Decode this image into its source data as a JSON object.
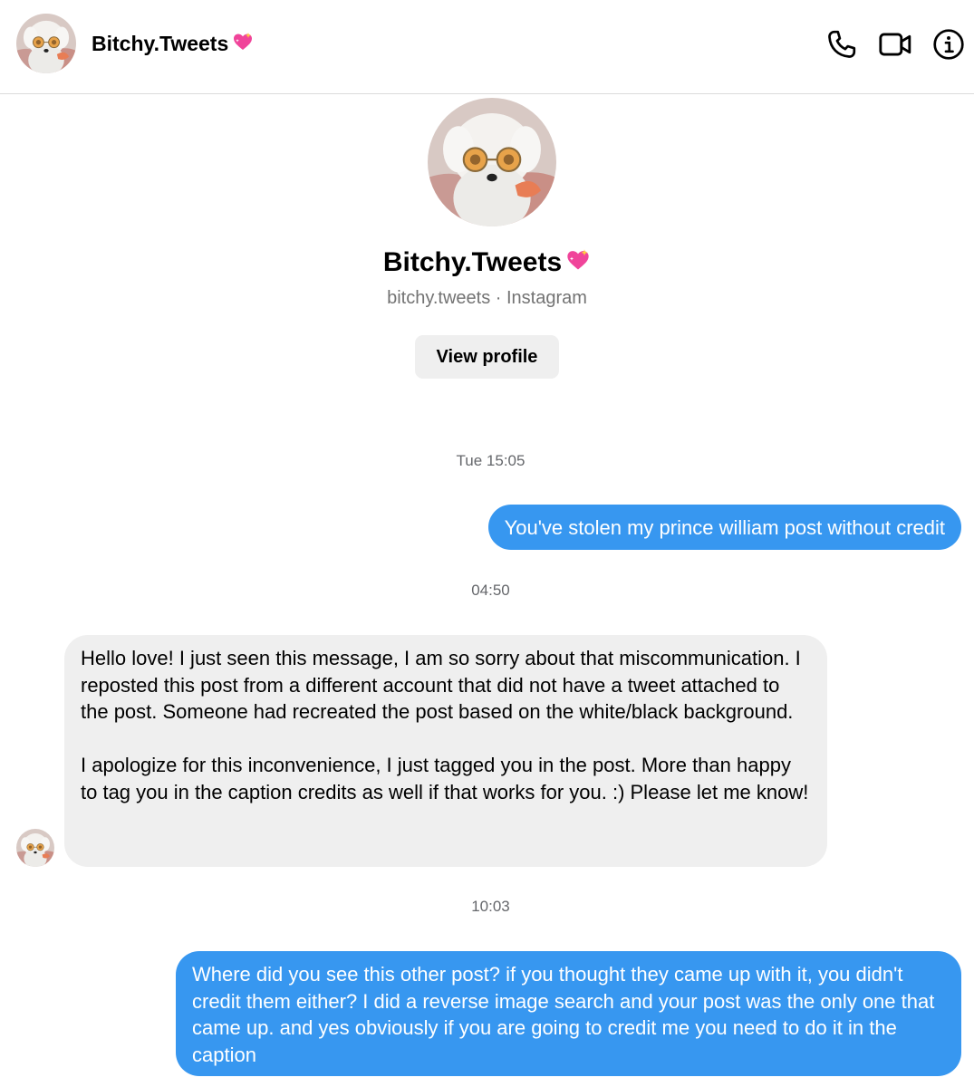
{
  "header": {
    "name": "Bitchy.Tweets",
    "heart_icon": "sparkling-heart-icon",
    "actions": [
      "phone-icon",
      "video-icon",
      "info-icon"
    ]
  },
  "profile": {
    "name": "Bitchy.Tweets",
    "subtitle": "bitchy.tweets · Instagram",
    "view_profile_label": "View profile"
  },
  "conversation": {
    "timestamps": [
      "Tue 15:05",
      "04:50",
      "10:03"
    ],
    "messages": [
      {
        "direction": "outgoing",
        "text": "You've stolen my prince william post without credit"
      },
      {
        "direction": "incoming",
        "text": "Hello love! I just seen this message, I am so sorry about that miscommunication. I reposted this post from a different account that did not have a tweet attached to the post. Someone had recreated the post based on the white/black background.\n\nI apologize for this inconvenience, I just tagged you in the post. More than happy to tag you in the caption credits as well if that works for you. :) Please let me know!"
      },
      {
        "direction": "outgoing",
        "text": "Where did you see this other post? if you thought they came up with it, you didn't credit them either? I did a reverse image search and your post was the only one that came up. and yes obviously if you are going to credit me you need to do it in the caption"
      }
    ]
  },
  "colors": {
    "outgoing_bubble": "#3797f0",
    "incoming_bubble": "#efefef",
    "timestamp_text": "#65676b",
    "subtitle_text": "#737373"
  }
}
